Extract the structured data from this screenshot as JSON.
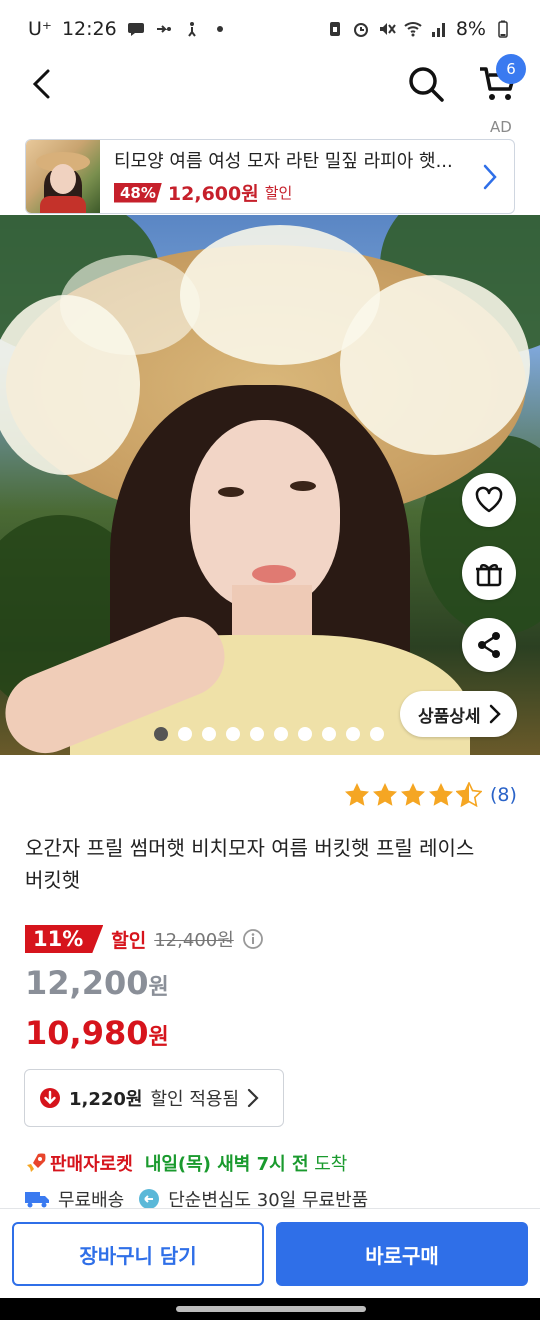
{
  "status_bar": {
    "carrier": "U⁺",
    "time": "12:26",
    "battery": "8%"
  },
  "header": {
    "cart_count": "6"
  },
  "ad": {
    "label": "AD",
    "title": "티모양 여름 여성 모자 라탄 밀짚 라피아 햇...",
    "discount_pct": "48%",
    "price": "12,600원",
    "discount_label": "할인"
  },
  "gallery": {
    "detail_button_label": "상품상세",
    "image_count": 10,
    "active_index": 0
  },
  "rating": {
    "stars": 4.5,
    "count": "(8)"
  },
  "product": {
    "title": "오간자 프릴 썸머햇 비치모자 여름 버킷햇 프릴 레이스 버킷햇",
    "discount_pct": "11%",
    "discount_label": "할인",
    "original_price": "12,400원",
    "list_price": "12,200",
    "list_price_unit": "원",
    "sale_price": "10,980",
    "sale_price_unit": "원"
  },
  "coupon": {
    "amount": "1,220원",
    "text": "할인 적용됨"
  },
  "delivery": {
    "rocket_label": "판매자로켓",
    "arrival_bold": "내일(목) 새벽 7시 전",
    "arrival_suffix": "도착",
    "free_shipping": "무료배송",
    "free_return": "단순변심도 30일 무료반품"
  },
  "actions": {
    "add_to_cart": "장바구니 담기",
    "buy_now": "바로구매"
  },
  "colors": {
    "primary_blue": "#2f6fe8",
    "sale_red": "#d6141c",
    "arrival_green": "#1a9a2e",
    "star_orange": "#f5a623"
  }
}
